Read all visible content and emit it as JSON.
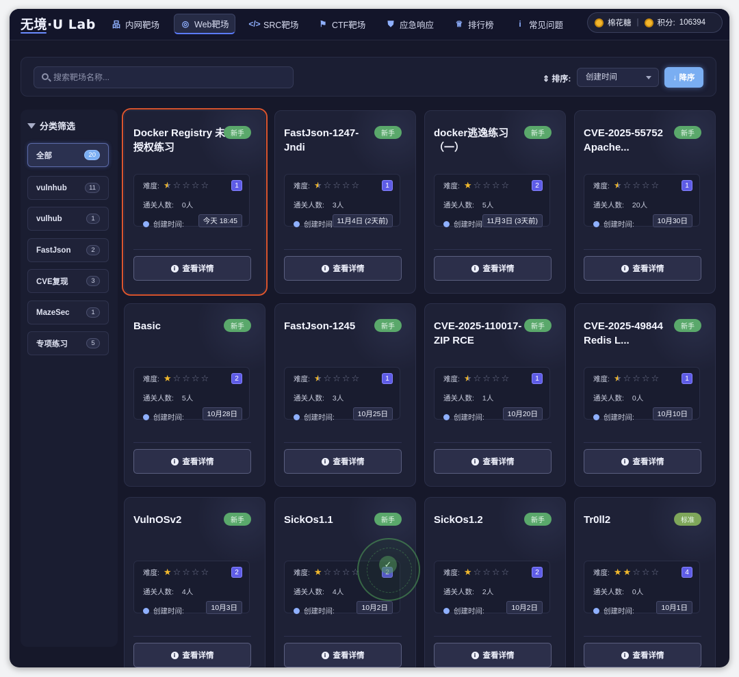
{
  "app": {
    "logo": "无境·U Lab"
  },
  "nav": {
    "items": [
      {
        "label": "内网靶场",
        "icon": "network-icon",
        "glyph": "品"
      },
      {
        "label": "Web靶场",
        "icon": "globe-icon",
        "glyph": "◎"
      },
      {
        "label": "SRC靶场",
        "icon": "code-icon",
        "glyph": "</>"
      },
      {
        "label": "CTF靶场",
        "icon": "flag-icon",
        "glyph": "⚑"
      },
      {
        "label": "应急响应",
        "icon": "shield-icon",
        "glyph": "⛊"
      },
      {
        "label": "排行榜",
        "icon": "trophy-icon",
        "glyph": "♕"
      },
      {
        "label": "常见问题",
        "icon": "info-icon",
        "glyph": "i"
      }
    ],
    "active": "Web靶场"
  },
  "user": {
    "name": "棉花糖",
    "sep": "|",
    "points_label": "积分:",
    "points": "106394"
  },
  "search": {
    "placeholder": "搜索靶场名称..."
  },
  "sort": {
    "label": "⇕ 排序:",
    "selected": "创建时间",
    "order_button": "↓ 降序"
  },
  "sidebar": {
    "title": "分类筛选",
    "items": [
      {
        "label": "全部",
        "count": "20"
      },
      {
        "label": "vulnhub",
        "count": "11"
      },
      {
        "label": "vulhub",
        "count": "1"
      },
      {
        "label": "FastJson",
        "count": "2"
      },
      {
        "label": "CVE复现",
        "count": "3"
      },
      {
        "label": "MazeSec",
        "count": "1"
      },
      {
        "label": "专项练习",
        "count": "5"
      }
    ]
  },
  "labels": {
    "difficulty": "难度:",
    "passed": "通关人数:",
    "created": "创建时间:",
    "detail_button": "查看详情"
  },
  "cards": [
    {
      "title": "Docker Registry 未授权练习",
      "level": "新手",
      "stars": 0.5,
      "num": "1",
      "passed": "0人",
      "date": "今天 18:45"
    },
    {
      "title": "FastJson-1247-Jndi",
      "level": "新手",
      "stars": 0.5,
      "num": "1",
      "passed": "3人",
      "date": "11月4日 (2天前)"
    },
    {
      "title": "docker逃逸练习（一）",
      "level": "新手",
      "stars": 1,
      "num": "2",
      "passed": "5人",
      "date": "11月3日 (3天前)"
    },
    {
      "title": "CVE-2025-55752 Apache...",
      "level": "新手",
      "stars": 0.5,
      "num": "1",
      "passed": "20人",
      "date": "10月30日"
    },
    {
      "title": "Basic",
      "level": "新手",
      "stars": 1,
      "num": "2",
      "passed": "5人",
      "date": "10月28日"
    },
    {
      "title": "FastJson-1245",
      "level": "新手",
      "stars": 0.5,
      "num": "1",
      "passed": "3人",
      "date": "10月25日"
    },
    {
      "title": "CVE-2025-110017-ZIP RCE",
      "level": "新手",
      "stars": 0.5,
      "num": "1",
      "passed": "1人",
      "date": "10月20日"
    },
    {
      "title": "CVE-2025-49844 Redis L...",
      "level": "新手",
      "stars": 0.5,
      "num": "1",
      "passed": "0人",
      "date": "10月10日"
    },
    {
      "title": "VulnOSv2",
      "level": "新手",
      "stars": 1,
      "num": "2",
      "passed": "4人",
      "date": "10月3日"
    },
    {
      "title": "SickOs1.1",
      "level": "新手",
      "stars": 1,
      "num": "2",
      "passed": "4人",
      "date": "10月2日"
    },
    {
      "title": "SickOs1.2",
      "level": "新手",
      "stars": 1,
      "num": "2",
      "passed": "2人",
      "date": "10月2日"
    },
    {
      "title": "Tr0ll2",
      "level": "标准",
      "stars": 2,
      "num": "4",
      "passed": "0人",
      "date": "10月1日"
    }
  ],
  "colors": {
    "accent": "#5b7bff",
    "tag_green": "#5aa86b",
    "tag_standard": "#7ea65a",
    "star": "#f2b92d",
    "selected_outline": "#d9552f"
  }
}
